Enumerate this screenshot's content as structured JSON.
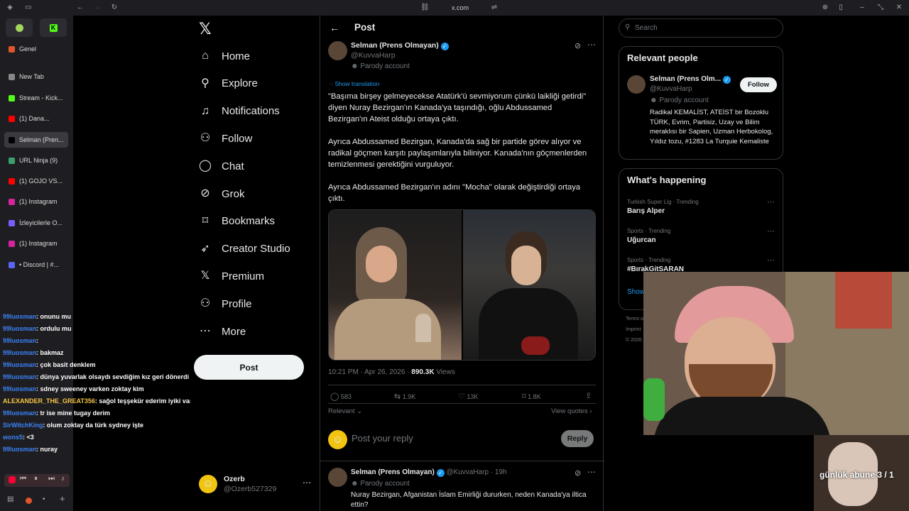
{
  "browser": {
    "url": "x.com"
  },
  "tabs": [
    {
      "label": "Genel",
      "color": "#e0552b"
    },
    {
      "label": "New Tab",
      "color": "#888888"
    },
    {
      "label": "Stream - Kick...",
      "color": "#53fc18"
    },
    {
      "label": "(1) Dana...",
      "color": "#ff0000"
    },
    {
      "label": "Selman (Pren...",
      "color": "#000000"
    },
    {
      "label": "URL Ninja (9)",
      "color": "#39a06a"
    },
    {
      "label": "(1) GOJO VS...",
      "color": "#ff0000"
    },
    {
      "label": "(1) Instagram",
      "color": "#d6249f"
    },
    {
      "label": "İzleyicilerle O...",
      "color": "#7a5cff"
    },
    {
      "label": "(1) Instagram",
      "color": "#d6249f"
    },
    {
      "label": "• Discord | #...",
      "color": "#5865f2"
    }
  ],
  "chat": [
    {
      "user": "99luosman",
      "msg": ": onunu mu",
      "yellow": false
    },
    {
      "user": "99luosman",
      "msg": ": ordulu mu",
      "yellow": false
    },
    {
      "user": "99luosman",
      "msg": ":",
      "yellow": false
    },
    {
      "user": "99luosman",
      "msg": ": bakmaz",
      "yellow": false
    },
    {
      "user": "99luosman",
      "msg": ": çok basit denklem",
      "yellow": false
    },
    {
      "user": "99luosman",
      "msg": ": dünya yuvarlak olsaydı sevdiğim kız geri dönerdi",
      "yellow": false
    },
    {
      "user": "99luosman",
      "msg": ": sdney sweeney varken zoktay kim",
      "yellow": false
    },
    {
      "user": "ALEXANDER_THE_GREAT356",
      "msg": ": sağol teşşekür ederim iyiki varsır",
      "yellow": true
    },
    {
      "user": "99luosman",
      "msg": ": tr ise mine tugay derim",
      "yellow": false
    },
    {
      "user": "SirWitchKing",
      "msg": ": olum zoktay da türk sydney işte",
      "yellow": false
    },
    {
      "user": "wons5",
      "msg": ": <3",
      "yellow": false
    },
    {
      "user": "99luosman",
      "msg": ": nuray",
      "yellow": false
    }
  ],
  "nav": {
    "items": [
      {
        "label": "Home",
        "icon": "home-icon",
        "glyph": "⌂"
      },
      {
        "label": "Explore",
        "icon": "search-icon",
        "glyph": "⚲"
      },
      {
        "label": "Notifications",
        "icon": "bell-icon",
        "glyph": "♫"
      },
      {
        "label": "Follow",
        "icon": "add-person-icon",
        "glyph": "⚇"
      },
      {
        "label": "Chat",
        "icon": "chat-icon",
        "glyph": "◯"
      },
      {
        "label": "Grok",
        "icon": "grok-icon",
        "glyph": "⊘"
      },
      {
        "label": "Bookmarks",
        "icon": "bookmark-icon",
        "glyph": "⌑"
      },
      {
        "label": "Creator Studio",
        "icon": "rocket-icon",
        "glyph": "➶"
      },
      {
        "label": "Premium",
        "icon": "x-logo-icon",
        "glyph": "𝕏"
      },
      {
        "label": "Profile",
        "icon": "profile-icon",
        "glyph": "⚇"
      },
      {
        "label": "More",
        "icon": "more-icon",
        "glyph": "⋯"
      }
    ],
    "post_label": "Post",
    "me": {
      "name": "Ozerb",
      "handle": "@Ozerb527329"
    }
  },
  "post": {
    "header": "Post",
    "author": {
      "name": "Selman (Prens Olmayan)",
      "handle": "@KuvvaHarp",
      "badge": "Parody account"
    },
    "show_translation": "Show translation",
    "paragraphs": [
      "\"Başıma birşey gelmeyecekse Atatürk'ü sevmiyorum çünkü laikliği getirdi\" diyen Nuray Bezirgan'ın Kanada'ya taşındığı, oğlu Abdussamed Bezirgan'ın Ateist olduğu ortaya çıktı.",
      "Ayrıca Abdussamed Bezirgan, Kanada'da sağ bir partide görev alıyor ve radikal göçmen karşıtı paylaşımlarıyla biliniyor. Kanada'nın göçmenlerden temizlenmesi gerektiğini vurguluyor.",
      "Ayrıca Abdussamed Bezirgan'ın adını \"Mocha\" olarak değiştirdiği ortaya çıktı."
    ],
    "time": "10:21 PM · Apr 26, 2026 · ",
    "views": "890.3K",
    "views_label": " Views",
    "stats": {
      "replies": "583",
      "reposts": "1.9K",
      "likes": "13K",
      "bookmarks": "1.8K"
    },
    "sort": "Relevant",
    "view_quotes": "View quotes",
    "reply_placeholder": "Post your reply",
    "reply_button": "Reply"
  },
  "reply_tweet": {
    "name": "Selman (Prens Olmayan)",
    "meta": "@KuvvaHarp · 19h",
    "badge": "Parody account",
    "text": "Nuray Bezirgan, Afganistan İslam Emirliği dururken, neden Kanada'ya iltica ettin?"
  },
  "right": {
    "search_placeholder": "Search",
    "relevant_title": "Relevant people",
    "person": {
      "name": "Selman (Prens Olm...",
      "handle": "@KuvvaHarp",
      "badge": "Parody account",
      "bio": "Radikal KEMALİST, ATEİST bir Bozoklu TÜRK, Evrim, Partisiz, Uzay ve Bilim meraklısı bir Sapien, Uzman Herbokolog, Yıldız tozu, #1283 La Turquie Kemaliste",
      "follow": "Follow"
    },
    "happening_title": "What's happening",
    "trends": [
      {
        "context": "Turkish Super Lig · Trending",
        "topic": "Barış Alper"
      },
      {
        "context": "Sports · Trending",
        "topic": "Uğurcan"
      },
      {
        "context": "Sports · Trending",
        "topic": "#BırakGitSARAN"
      }
    ],
    "show_more": "Show",
    "footer": [
      "Terms o",
      "Imprint",
      "© 2026"
    ]
  },
  "stream_overlay": "günlük abune 3 / 1",
  "colors": {
    "accent": "#1d9bf0",
    "bg": "#000000",
    "border": "#2f3336",
    "muted": "#71767b"
  }
}
